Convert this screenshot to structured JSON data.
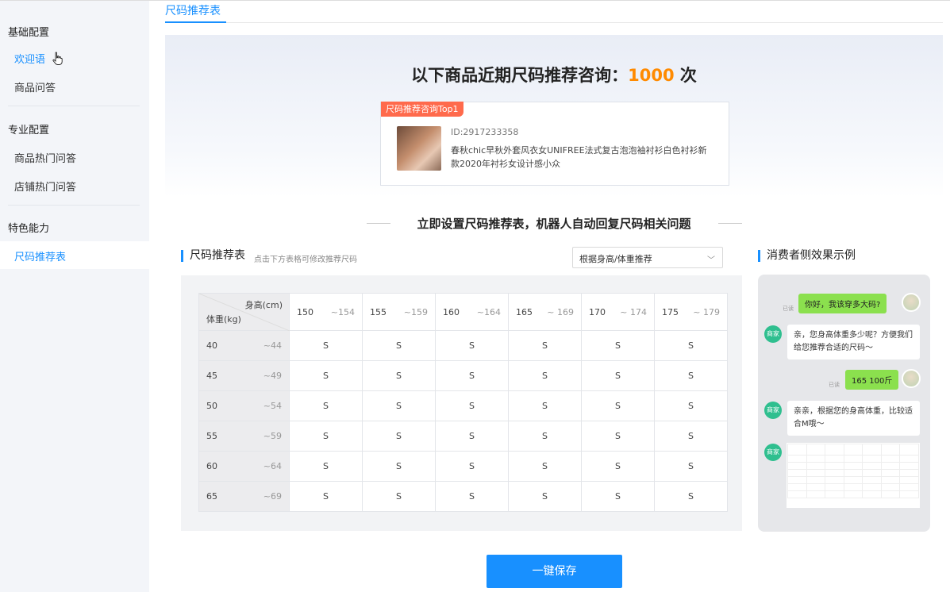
{
  "sidebar": {
    "groups": [
      {
        "title": "基础配置",
        "items": [
          "欢迎语",
          "商品问答"
        ]
      },
      {
        "title": "专业配置",
        "items": [
          "商品热门问答",
          "店铺热门问答"
        ]
      },
      {
        "title": "特色能力",
        "items": [
          "尺码推荐表"
        ]
      }
    ]
  },
  "tab": {
    "label": "尺码推荐表"
  },
  "hero": {
    "title_prefix": "以下商品近期尺码推荐咨询：",
    "count": "1000",
    "title_suffix": " 次",
    "badge": "尺码推荐咨询Top1",
    "product_id": "ID:2917233358",
    "product_desc": "春秋chic早秋外套风衣女UNIFREE法式复古泡泡袖衬衫白色衬衫新款2020年衬衫女设计感小众"
  },
  "section_title": "立即设置尺码推荐表，机器人自动回复尺码相关问题",
  "size_table": {
    "title": "尺码推荐表",
    "hint": "点击下方表格可修改推荐尺码",
    "select_value": "根据身高/体重推荐",
    "corner_top": "身高(cm)",
    "corner_bottom": "体重(kg)",
    "height_ranges": [
      [
        "150",
        "~154"
      ],
      [
        "155",
        "~159"
      ],
      [
        "160",
        "~164"
      ],
      [
        "165",
        "~ 169"
      ],
      [
        "170",
        "~ 174"
      ],
      [
        "175",
        "~ 179"
      ]
    ],
    "rows": [
      {
        "from": "40",
        "to": "~44",
        "cells": [
          "S",
          "S",
          "S",
          "S",
          "S",
          "S"
        ]
      },
      {
        "from": "45",
        "to": "~49",
        "cells": [
          "S",
          "S",
          "S",
          "S",
          "S",
          "S"
        ]
      },
      {
        "from": "50",
        "to": "~54",
        "cells": [
          "S",
          "S",
          "S",
          "S",
          "S",
          "S"
        ]
      },
      {
        "from": "55",
        "to": "~59",
        "cells": [
          "S",
          "S",
          "S",
          "S",
          "S",
          "S"
        ]
      },
      {
        "from": "60",
        "to": "~64",
        "cells": [
          "S",
          "S",
          "S",
          "S",
          "S",
          "S"
        ]
      },
      {
        "from": "65",
        "to": "~69",
        "cells": [
          "S",
          "S",
          "S",
          "S",
          "S",
          "S"
        ]
      }
    ]
  },
  "preview": {
    "title": "消费者侧效果示例",
    "read_label": "已读",
    "bot_avatar": "商家",
    "msg_user_1": "你好，我该穿多大码?",
    "msg_bot_1": "亲，您身高体重多少呢？方便我们给您推荐合适的尺码～",
    "msg_user_2": "165  100斤",
    "msg_bot_2": "亲亲，根据您的身高体重，比较适合M哦～"
  },
  "save_button": "一键保存"
}
